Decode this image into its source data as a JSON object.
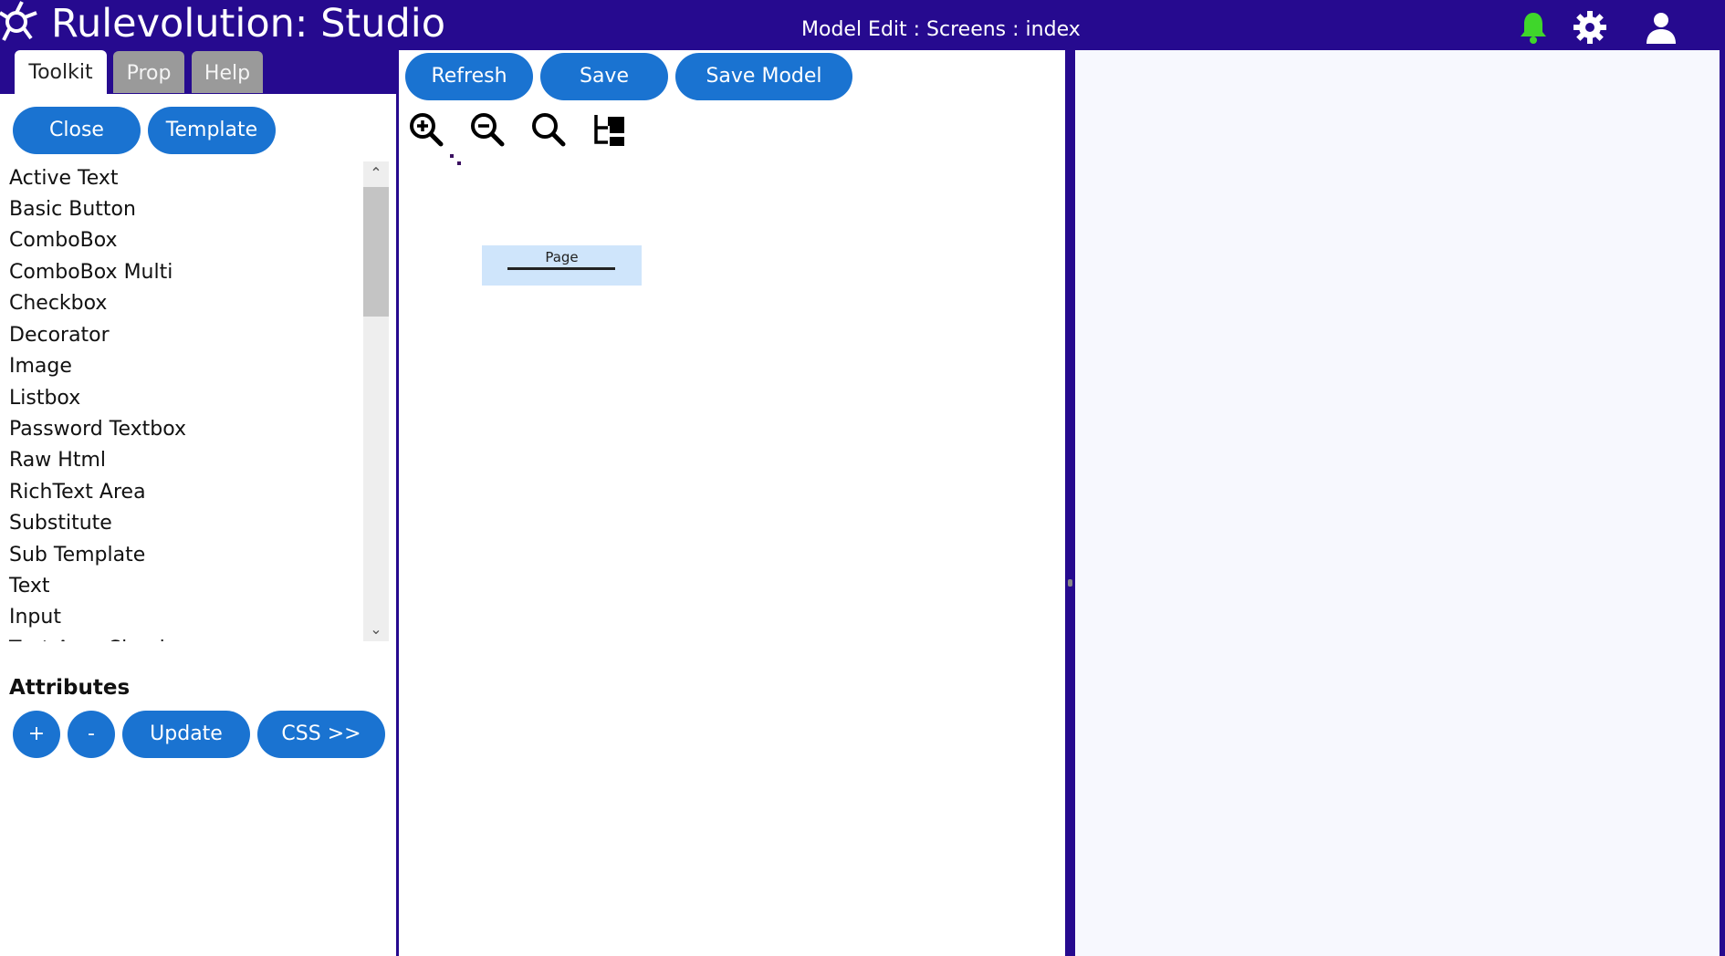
{
  "header": {
    "app_title": "Rulevolution: Studio",
    "screen_title": "Model Edit : Screens : index",
    "icons": [
      "bell-icon",
      "gear-icon",
      "user-icon"
    ],
    "bell_color": "#3fd62b",
    "background_color": "#260a8f"
  },
  "tabs": [
    {
      "label": "Toolkit",
      "active": true
    },
    {
      "label": "Prop",
      "active": false
    },
    {
      "label": "Help",
      "active": false
    }
  ],
  "toolkit": {
    "close_label": "Close",
    "template_label": "Template",
    "items": [
      "Active Text",
      "Basic Button",
      "ComboBox",
      "ComboBox Multi",
      "Checkbox",
      "Decorator",
      "Image",
      "Listbox",
      "Password Textbox",
      "Raw Html",
      "RichText Area",
      "Substitute",
      "Sub Template",
      "Text",
      "Input",
      "Text Area Simple"
    ]
  },
  "attributes": {
    "title": "Attributes",
    "add_label": "+",
    "remove_label": "-",
    "update_label": "Update",
    "css_label": "CSS >>"
  },
  "editor": {
    "refresh_label": "Refresh",
    "save_label": "Save",
    "save_model_label": "Save Model",
    "tools": [
      "zoom-in-icon",
      "zoom-out-icon",
      "zoom-reset-icon",
      "tree-layout-icon"
    ],
    "canvas_node_label": "Page"
  },
  "colors": {
    "accent": "#1a73d1",
    "brand": "#260a8f",
    "tab_inactive": "#9a9a9a",
    "node_fill": "#cfe5fb"
  }
}
